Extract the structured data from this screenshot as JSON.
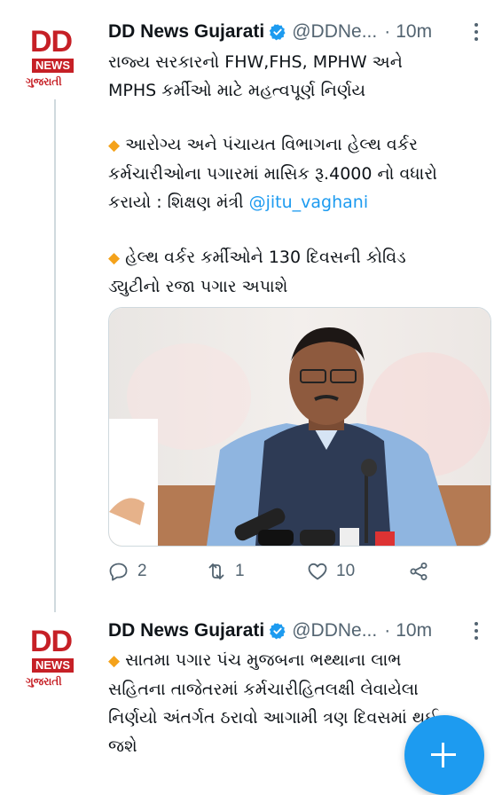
{
  "tweets": [
    {
      "author_name": "DD News Gujarati",
      "handle": "@DDNe...",
      "separator": "·",
      "time": "10m",
      "logo": {
        "top": "DD",
        "badge": "NEWS",
        "sub": "ગુજરાતી"
      },
      "lines": [
        "રાજ્ય સરકારનો FHW,FHS, MPHW અને",
        "MPHS કર્મીઓ માટે મહત્વપૂર્ણ નિર્ણય"
      ],
      "bullet1": {
        "marker": "◆",
        "lines": [
          "આરોગ્ય અને પંચાયત વિભાગના હેલ્થ વર્કર",
          "કર્મચારીઓના પગારમાં માસિક રૂ.4000 નો વધારો"
        ],
        "last_line_prefix": "કરાયો : શિક્ષણ મંત્રી ",
        "mention": "@jitu_vaghani"
      },
      "bullet2": {
        "marker": "◆",
        "lines": [
          "હેલ્થ વર્કર કર્મીઓને 130 દિવસની  કોવિડ",
          "ડ્યુટીનો રજા પગાર અપાશે"
        ]
      },
      "image": {
        "subject": "minister-at-press-conference"
      },
      "actions": {
        "reply_count": "2",
        "retweet_count": "1",
        "like_count": "10"
      }
    },
    {
      "author_name": "DD News Gujarati",
      "handle": "@DDNe...",
      "separator": "·",
      "time": "10m",
      "logo": {
        "top": "DD",
        "badge": "NEWS",
        "sub": "ગુજરાતી"
      },
      "bullet": {
        "marker": "◆",
        "first_line": "સાતમા પગાર પંચ મુજબના ભથ્થાના લાભ",
        "lines": [
          "સહિતના તાજેતરમાં કર્મચારીહિતલક્ષી લેવાયેલા",
          "નિર્ણયો અંતર્ગત ઠરાવો આગામી ત્રણ દિવસમાં થઈ",
          "જશે"
        ]
      }
    }
  ],
  "fab": {
    "icon": "plus-icon"
  },
  "colors": {
    "accent": "#1d9bf0",
    "brand_red": "#c62026",
    "bullet_orange": "#f4a21b",
    "muted_text": "#536471"
  }
}
